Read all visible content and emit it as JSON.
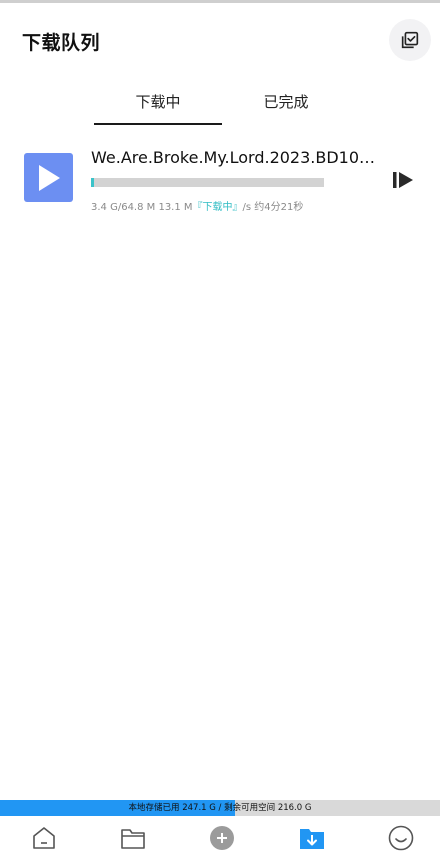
{
  "header": {
    "title": "下载队列",
    "action_icon": "checklist-icon"
  },
  "tabs": [
    {
      "label": "下载中",
      "active": true
    },
    {
      "label": "已完成",
      "active": false
    }
  ],
  "downloads": [
    {
      "name": "We.Are.Broke.My.Lord.2023.BD108...",
      "progress_fraction": 0.013,
      "size_text": "3.4 G/64.8 M 13.1 M",
      "status_text": "『下载中』",
      "speed_text": "/s 约4分21秒",
      "icon": "play-icon",
      "action_icon": "resume-icon"
    }
  ],
  "storage": {
    "text": "本地存储已用 247.1 G / 剩余可用空间 216.0 G",
    "used_fraction": 0.534,
    "colors": {
      "used": "#2196f3",
      "free": "#d9d9d9"
    }
  },
  "nav": [
    {
      "icon": "home-icon",
      "active": false
    },
    {
      "icon": "folder-icon",
      "active": false
    },
    {
      "icon": "add-icon",
      "active": false
    },
    {
      "icon": "download-folder-icon",
      "active": true
    },
    {
      "icon": "smile-icon",
      "active": false
    }
  ],
  "colors": {
    "accent": "#2196f3",
    "thumbnail": "#6c8ff2",
    "progress": "#3bc3c9",
    "status": "#2fbcc3"
  }
}
